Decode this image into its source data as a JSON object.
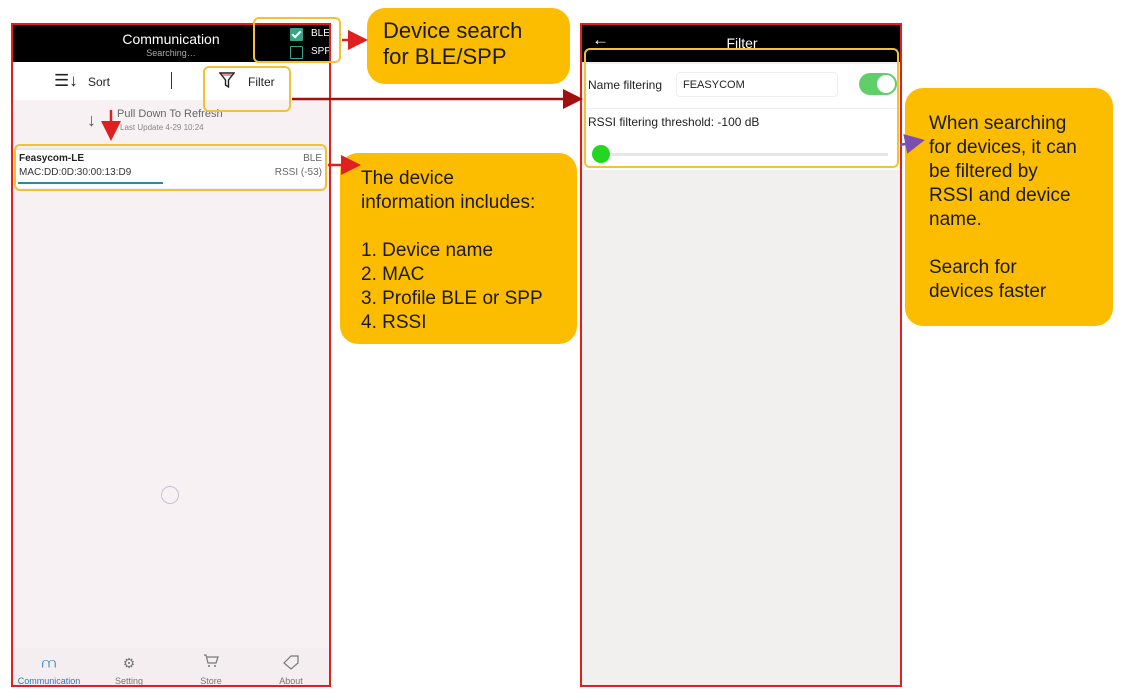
{
  "phone1": {
    "header": {
      "title": "Communication",
      "subtitle": "Searching…"
    },
    "checkboxes": [
      {
        "label": "BLE",
        "checked": true
      },
      {
        "label": "SPP",
        "checked": false
      }
    ],
    "toolbar": {
      "sort_label": "Sort",
      "filter_label": "Filter"
    },
    "refresh": {
      "text": "Pull Down To Refresh",
      "last_update": "Last Update 4-29 10:24"
    },
    "device": {
      "name": "Feasycom-LE",
      "profile": "BLE",
      "mac": "MAC:DD:0D:30:00:13:D9",
      "rssi": "RSSI (-53)"
    },
    "nav": [
      {
        "label": "Communication",
        "icon": "network-icon",
        "active": true
      },
      {
        "label": "Setting",
        "icon": "gear-icon",
        "active": false
      },
      {
        "label": "Store",
        "icon": "cart-icon",
        "active": false
      },
      {
        "label": "About",
        "icon": "tag-icon",
        "active": false
      }
    ]
  },
  "phone2": {
    "header": {
      "title": "Filter"
    },
    "name_filter": {
      "label": "Name filtering",
      "value": "FEASYCOM",
      "enabled": true
    },
    "rssi_filter": {
      "label": "RSSI filtering threshold:  -100 dB",
      "slider_fraction": 0
    }
  },
  "callouts": {
    "device_search": "Device search\nfor BLE/SPP",
    "device_info": "The device\ninformation  includes:\n\n1. Device name\n2. MAC\n3. Profile BLE or SPP\n4. RSSI",
    "filter_info": "When searching\nfor devices, it can\nbe filtered by\nRSSI  and device\nname.\n\nSearch for\ndevices faster"
  },
  "colors": {
    "accent_green": "#5fcf6a",
    "callout_yellow": "#fcbd00",
    "highlight": "#f2c233",
    "red": "#e02020",
    "arrow_purple": "#7b4fb0"
  }
}
